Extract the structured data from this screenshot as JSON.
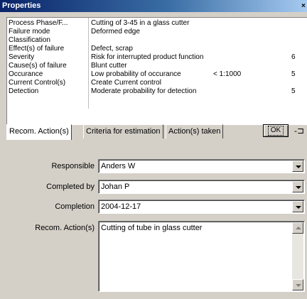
{
  "window": {
    "title": "Properties"
  },
  "properties": {
    "rows": [
      {
        "label": "Process Phase/F...",
        "value": "Cutting of 3-45 in a glass cutter",
        "note": "",
        "score": ""
      },
      {
        "label": "Failure mode",
        "value": "Deformed edge",
        "note": "",
        "score": ""
      },
      {
        "label": "Classification",
        "value": "",
        "note": "",
        "score": ""
      },
      {
        "label": "Effect(s) of failure",
        "value": "Defect, scrap",
        "note": "",
        "score": ""
      },
      {
        "label": "Severity",
        "value": "Risk for interrupted product function",
        "note": "",
        "score": "6"
      },
      {
        "label": "Cause(s) of failure",
        "value": "Blunt cutter",
        "note": "",
        "score": ""
      },
      {
        "label": "Occurance",
        "value": "Low probability of occurance",
        "note": "< 1:1000",
        "score": "5"
      },
      {
        "label": "Current Control(s)",
        "value": "Create Current control",
        "note": "",
        "score": ""
      },
      {
        "label": "Detection",
        "value": "Moderate probability for detection",
        "note": "",
        "score": "5"
      }
    ]
  },
  "tabs": [
    {
      "label": "Recom. Action(s)",
      "active": true
    },
    {
      "label": "Criteria for estimation",
      "active": false
    },
    {
      "label": "Action(s) taken",
      "active": false
    }
  ],
  "toolbar": {
    "ok_label": "OK",
    "pin_glyph": "-⊐"
  },
  "form": {
    "responsible": {
      "label": "Responsible",
      "value": "Anders W"
    },
    "completed_by": {
      "label": "Completed by",
      "value": "Johan P"
    },
    "completion": {
      "label": "Completion",
      "value": "2004-12-17"
    },
    "recom_action": {
      "label": "Recom. Action(s)",
      "value": "Cutting of tube in glass cutter"
    }
  },
  "icons": {
    "dropdown": "chevron-down-icon",
    "scroll_up": "scroll-up-icon",
    "scroll_down": "scroll-down-icon"
  }
}
